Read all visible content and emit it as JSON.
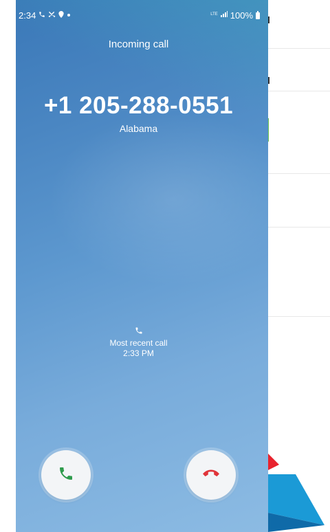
{
  "status_bar": {
    "time": "2:34",
    "network": "LTE",
    "battery": "100%"
  },
  "call": {
    "status_label": "Incoming call",
    "number": "+1 205-288-0551",
    "location": "Alabama"
  },
  "recent": {
    "label": "Most recent call",
    "time": "2:33 PM"
  },
  "actions": {
    "accept_color": "#2e9b4c",
    "decline_color": "#e0343a"
  },
  "icons": {
    "status_left": [
      "phone-icon",
      "missed-call-icon",
      "location-icon",
      "dot-icon"
    ],
    "status_right": [
      "lte-icon",
      "signal-icon",
      "battery-icon"
    ],
    "recent": "phone-icon",
    "accept": "phone-accept-icon",
    "decline": "phone-decline-icon"
  }
}
